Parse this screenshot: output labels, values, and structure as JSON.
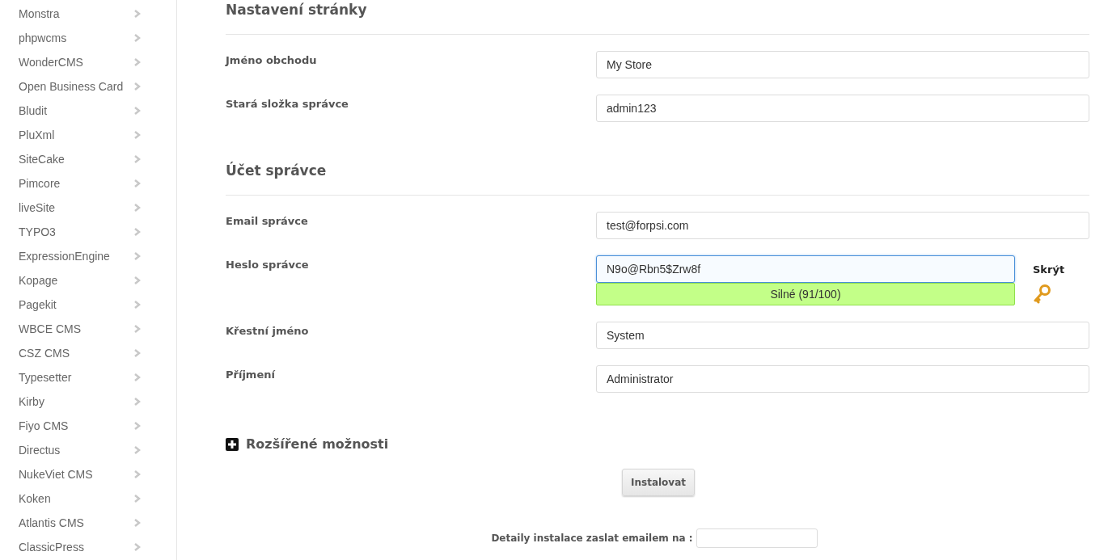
{
  "sidebar": {
    "items": [
      {
        "label": "Monstra"
      },
      {
        "label": "phpwcms"
      },
      {
        "label": "WonderCMS"
      },
      {
        "label": "Open Business Card"
      },
      {
        "label": "Bludit"
      },
      {
        "label": "PluXml"
      },
      {
        "label": "SiteCake"
      },
      {
        "label": "Pimcore"
      },
      {
        "label": "liveSite"
      },
      {
        "label": "TYPO3"
      },
      {
        "label": "ExpressionEngine"
      },
      {
        "label": "Kopage"
      },
      {
        "label": "Pagekit"
      },
      {
        "label": "WBCE CMS"
      },
      {
        "label": "CSZ CMS"
      },
      {
        "label": "Typesetter"
      },
      {
        "label": "Kirby"
      },
      {
        "label": "Fiyo CMS"
      },
      {
        "label": "Directus"
      },
      {
        "label": "NukeViet CMS"
      },
      {
        "label": "Koken"
      },
      {
        "label": "Atlantis CMS"
      },
      {
        "label": "ClassicPress"
      }
    ]
  },
  "sections": [
    {
      "title": "Nastavení stránky",
      "fields": [
        {
          "kind": "text",
          "label": "Jméno obchodu",
          "value": "My Store",
          "focused": false
        },
        {
          "kind": "text",
          "label": "Stará složka správce",
          "value": "admin123",
          "focused": false
        }
      ]
    },
    {
      "title": "Účet správce",
      "fields": [
        {
          "kind": "text",
          "label": "Email správce",
          "value": "test@forpsi.com",
          "focused": false
        },
        {
          "kind": "password",
          "label": "Heslo správce",
          "value": "N9o@Rbn5$Zrw8f",
          "focused": true,
          "toggle": "Skrýt",
          "strength": "Silné (91/100)"
        },
        {
          "kind": "text",
          "label": "Křestní jméno",
          "value": "System",
          "focused": false
        },
        {
          "kind": "text",
          "label": "Příjmení",
          "value": "Administrator",
          "focused": false
        }
      ]
    }
  ],
  "advanced": {
    "label": "Rozšířené možnosti",
    "expanded": false
  },
  "install_button": "Instalovat",
  "email_details": {
    "label": "Detaily instalace zaslat emailem na :"
  }
}
